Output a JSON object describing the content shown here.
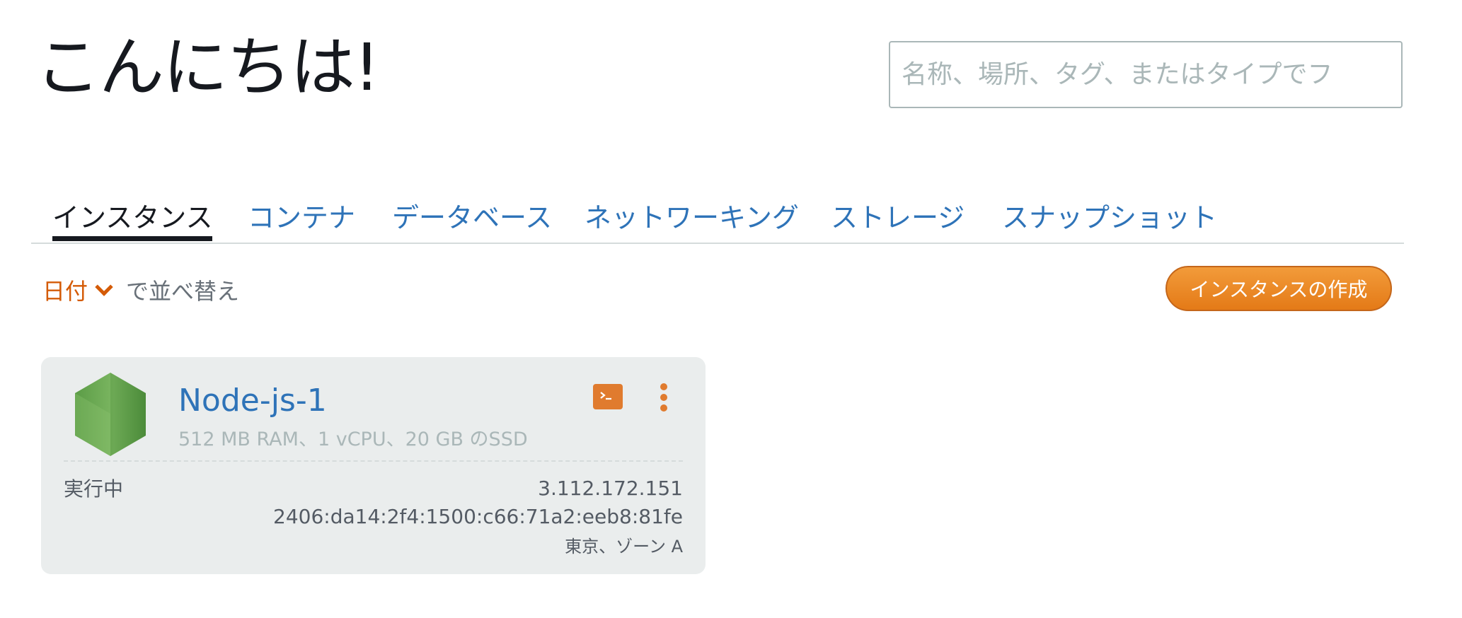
{
  "header": {
    "greeting": "こんにちは!",
    "search_placeholder": "名称、場所、タグ、またはタイプでフ"
  },
  "tabs": [
    {
      "label": "インスタンス",
      "active": true
    },
    {
      "label": "コンテナ"
    },
    {
      "label": "データベース"
    },
    {
      "label": "ネットワーキング"
    },
    {
      "label": "ストレージ"
    },
    {
      "label": "スナップショット"
    }
  ],
  "sort": {
    "field": "日付",
    "suffix": "で並べ替え"
  },
  "create_button": "インスタンスの作成",
  "instance": {
    "name": "Node-js-1",
    "spec": "512 MB RAM、1 vCPU、20 GB のSSD",
    "state": "実行中",
    "ipv4": "3.112.172.151",
    "ipv6": "2406:da14:2f4:1500:c66:71a2:eeb8:81fe",
    "location": "東京、ゾーン A",
    "blueprint_icon": "nodejs-icon",
    "ssh_icon": "terminal-icon",
    "menu_icon": "more-vertical-icon"
  },
  "colors": {
    "link": "#2e73b8",
    "accent": "#e47a17",
    "text": "#16191f",
    "card_bg": "#eaeded"
  }
}
